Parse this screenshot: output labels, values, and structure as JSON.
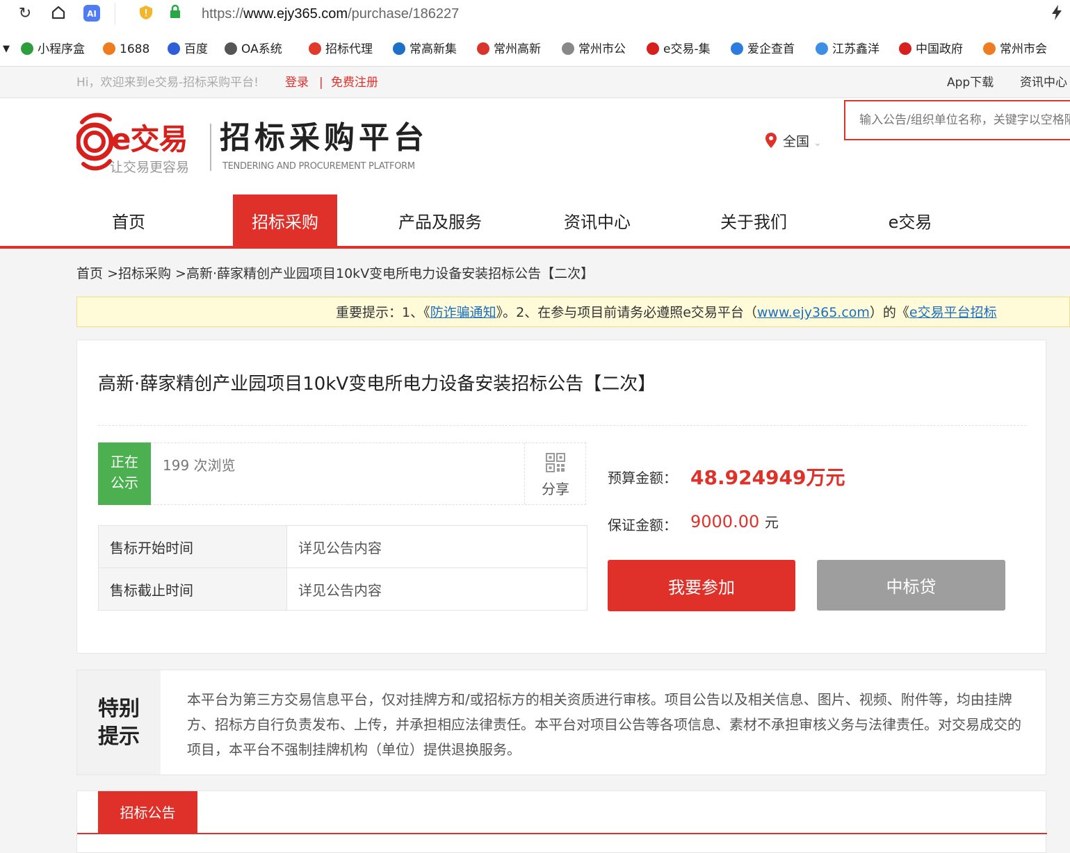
{
  "browser": {
    "url_prefix": "https://",
    "url_domain": "www.ejy365.com",
    "url_path": "/purchase/186227",
    "bookmarks": [
      {
        "label": "小程序盒",
        "icon": "shield-icon",
        "color": "#2e9d3c"
      },
      {
        "label": "1688",
        "icon": "1688-icon",
        "color": "#f07c22"
      },
      {
        "label": "百度",
        "icon": "baidu-icon",
        "color": "#2f5fd8"
      },
      {
        "label": "OA系统",
        "icon": "oa-icon",
        "color": "#555555"
      },
      {
        "label": "招标代理",
        "icon": "pdf-icon",
        "color": "#e03a2a"
      },
      {
        "label": "常高新集",
        "icon": "cgx-icon",
        "color": "#1e6fc8"
      },
      {
        "label": "常州高新",
        "icon": "czgx-icon",
        "color": "#d9342b"
      },
      {
        "label": "常州市公",
        "icon": "globe-icon",
        "color": "#888888"
      },
      {
        "label": "e交易-集",
        "icon": "ejy-icon",
        "color": "#d7201b"
      },
      {
        "label": "爱企查首",
        "icon": "aiqicha-icon",
        "color": "#2e7be0"
      },
      {
        "label": "江苏鑫洋",
        "icon": "jsxy-icon",
        "color": "#3d8ee5"
      },
      {
        "label": "中国政府",
        "icon": "emblem-icon",
        "color": "#d7201b"
      },
      {
        "label": "常州市会",
        "icon": "czsh-icon",
        "color": "#f07c22"
      }
    ]
  },
  "topbar": {
    "welcome": "Hi，欢迎来到e交易-招标采购平台!",
    "login": "登录",
    "sep": "|",
    "register": "免费注册",
    "app_download": "App下载",
    "news": "资讯中心"
  },
  "header": {
    "logo_name": "e交易",
    "logo_slogan": "让交易更容易",
    "platform": "招标采购平台",
    "platform_en": "TENDERING AND PROCUREMENT PLATFORM",
    "region": "全国",
    "search_placeholder": "输入公告/组织单位名称，关键字以空格隔开"
  },
  "nav": [
    "首页",
    "招标采购",
    "产品及服务",
    "资讯中心",
    "关于我们",
    "e交易"
  ],
  "breadcrumb": {
    "home": "首页",
    "section": "招标采购",
    "current": "高新·薛家精创产业园项目10kV变电所电力设备安装招标公告【二次】"
  },
  "notice": {
    "prefix": "重要提示：1、《",
    "link1": "防诈骗通知",
    "mid": "》。2、在参与项目前请务必遵照e交易平台（",
    "link2": "www.ejy365.com",
    "mid2": "）的《",
    "link3": "e交易平台招标"
  },
  "project": {
    "title": "高新·薛家精创产业园项目10kV变电所电力设备安装招标公告【二次】",
    "status": "正在公示",
    "views": "199 次浏览",
    "share": "分享",
    "rows": [
      {
        "key": "售标开始时间",
        "value": "详见公告内容"
      },
      {
        "key": "售标截止时间",
        "value": "详见公告内容"
      }
    ],
    "budget_label": "预算金额：",
    "budget_value": "48.924949万元",
    "deposit_label": "保证金额：",
    "deposit_value": "9000.00",
    "deposit_unit": "元",
    "join_button": "我要参加",
    "loan_button": "中标贷"
  },
  "special": {
    "heading_line1": "特别",
    "heading_line2": "提示",
    "text": "本平台为第三方交易信息平台，仅对挂牌方和/或招标方的相关资质进行审核。项目公告以及相关信息、图片、视频、附件等，均由挂牌方、招标方自行负责发布、上传，并承担相应法律责任。本平台对项目公告等各项信息、素材不承担审核义务与法律责任。对交易成交的项目，本平台不强制挂牌机构（单位）提供退换服务。"
  },
  "announcement_tab": "招标公告",
  "colors": {
    "accent": "#e0302a",
    "status_green": "#4cb050",
    "loan_gray": "#9e9e9e"
  }
}
